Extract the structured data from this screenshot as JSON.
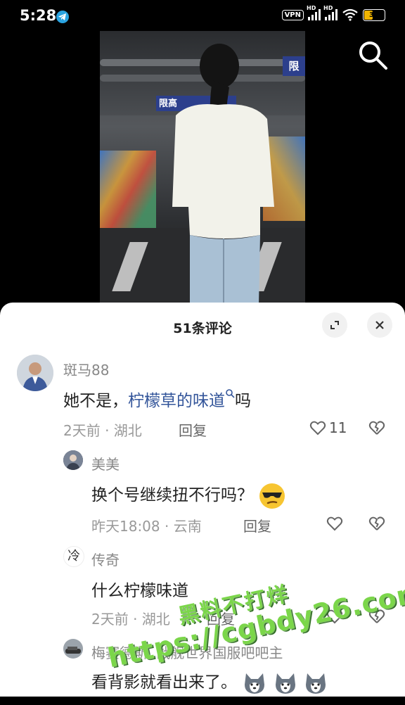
{
  "status_bar": {
    "time": "5:28",
    "vpn": "VPN",
    "hd1": "HD",
    "hd2": "HD",
    "battery": "39"
  },
  "sheet": {
    "title": "51条评论"
  },
  "comments": [
    {
      "name": "斑马88",
      "text_before": "她不是，",
      "link": "柠檬草的味道",
      "text_after": "吗",
      "meta": "2天前 · 湖北",
      "reply": "回复",
      "likes": "11"
    },
    {
      "name": "美美",
      "text": "换个号继续扭不行吗？",
      "meta": "昨天18:08 · 云南",
      "reply": "回复"
    },
    {
      "name": "传奇",
      "avatar_char": "冷",
      "text": "什么柠檬味道",
      "meta": "2天前 · 湖北",
      "reply": "回复"
    },
    {
      "name": "梅赛德斯",
      "badge": "战舰世界国服吧吧主",
      "text": "看背影就看出来了。"
    }
  ],
  "watermark": {
    "line1": "黑料不打烊",
    "line2": "https://cgbdy26.com"
  },
  "colors": {
    "link": "#33559a",
    "watermark": "#7bd64a",
    "battery": "#f0b400"
  }
}
